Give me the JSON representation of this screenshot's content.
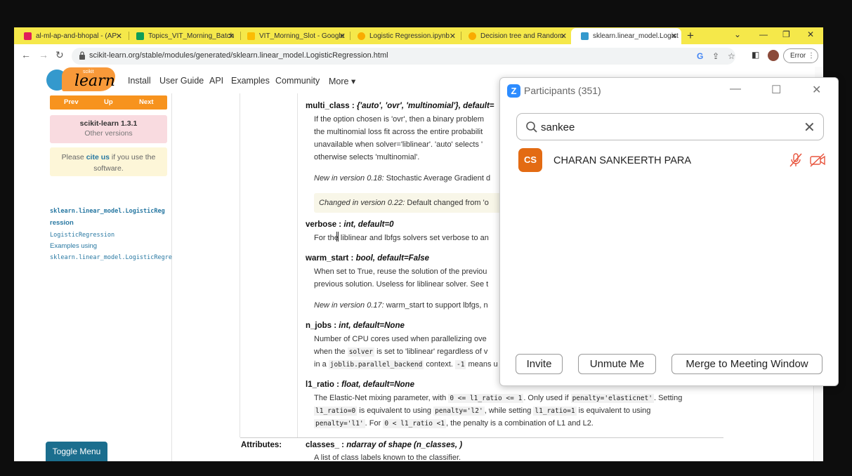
{
  "browser": {
    "tabs": [
      {
        "title": "al-ml-ap-and-bhopal - (AP",
        "favicon_color": "#e01e5a",
        "active": false
      },
      {
        "title": "Topics_VIT_Morning_Batch",
        "favicon_color": "#0f9d58",
        "active": false
      },
      {
        "title": "VIT_Morning_Slot - Google",
        "favicon_color": "#fbbc04",
        "active": false
      },
      {
        "title": "Logistic Regression.ipynb",
        "favicon_color": "#f9ab00",
        "active": false
      },
      {
        "title": "Decision tree and Random",
        "favicon_color": "#f9ab00",
        "active": false
      },
      {
        "title": "sklearn.linear_model.Logist",
        "favicon_color": "#3499cd",
        "active": true
      }
    ],
    "url": "scikit-learn.org/stable/modules/generated/sklearn.linear_model.LogisticRegression.html",
    "error_label": "Error"
  },
  "site_nav": {
    "logo_small": "scikit",
    "logo_text": "learn",
    "links": [
      "Install",
      "User Guide",
      "API",
      "Examples",
      "Community",
      "More ▾"
    ]
  },
  "sidebar": {
    "pager": {
      "prev": "Prev",
      "up": "Up",
      "next": "Next"
    },
    "version": "scikit-learn 1.3.1",
    "other_versions": "Other versions",
    "cite_pre": "Please ",
    "cite_link": "cite us",
    "cite_post": " if you use the software.",
    "toc": [
      "sklearn.linear_model.LogisticReg",
      "ression",
      "LogisticRegression",
      "Examples using",
      "sklearn.linear_model.LogisticRegre"
    ],
    "toggle_menu": "Toggle Menu"
  },
  "doc": {
    "multi_class": {
      "name": "multi_class : ",
      "type": "{'auto', 'ovr', 'multinomial'}, default=",
      "lines": [
        "If the option chosen is 'ovr', then a binary problem",
        "the multinomial loss fit across the entire probabilit",
        "unavailable when solver='liblinear'. 'auto' selects '",
        "otherwise selects 'multinomial'."
      ],
      "versionadded_label": "New in version 0.18:",
      "versionadded_text": " Stochastic Average Gradient d",
      "changed_label": "Changed in version 0.22:",
      "changed_text": " Default changed from 'o"
    },
    "verbose": {
      "name": "verbose : ",
      "type": "int, default=0",
      "line": "For the liblinear and lbfgs solvers set verbose to an"
    },
    "warm_start": {
      "name": "warm_start : ",
      "type": "bool, default=False",
      "lines": [
        "When set to True, reuse the solution of the previou",
        "previous solution. Useless for liblinear solver. See t"
      ],
      "versionadded_label": "New in version 0.17:",
      "versionadded_text": " warm_start to support lbfgs, n"
    },
    "n_jobs": {
      "name": "n_jobs : ",
      "type": "int, default=None",
      "line1": "Number of CPU cores used when parallelizing ove",
      "line2_pre": "when the ",
      "line2_code": "solver",
      "line2_post": " is set to 'liblinear' regardless of v",
      "line3_pre": "in a ",
      "line3_code": "joblib.parallel_backend",
      "line3_mid": " context. ",
      "line3_code2": "-1",
      "line3_post": " means u"
    },
    "l1_ratio": {
      "name": "l1_ratio : ",
      "type": "float, default=None",
      "l1_pre": "The Elastic-Net mixing parameter, with ",
      "l1_code1": "0 <= l1_ratio <= 1",
      "l1_mid": ". Only used if ",
      "l1_code2": "penalty='elasticnet'",
      "l1_post": ". Setting",
      "l2_code1": "l1_ratio=0",
      "l2_mid1": " is equivalent to using ",
      "l2_code2": "penalty='l2'",
      "l2_mid2": ", while setting ",
      "l2_code3": "l1_ratio=1",
      "l2_post": " is equivalent to using",
      "l3_code1": "penalty='l1'",
      "l3_mid": ". For ",
      "l3_code2": "0 < l1_ratio <1",
      "l3_post": ", the penalty is a combination of L1 and L2."
    },
    "attributes_label": "Attributes:",
    "classes": {
      "name": "classes_ : ",
      "type": "ndarray of shape (n_classes, )",
      "line": "A list of class labels known to the classifier."
    }
  },
  "zoom": {
    "title": "Participants (351)",
    "search_value": "sankee",
    "participant_initials": "CS",
    "participant_name": "CHARAN SANKEERTH PARA",
    "invite": "Invite",
    "unmute": "Unmute Me",
    "merge": "Merge to Meeting Window",
    "accent": "#2d8cff",
    "avatar_color": "#e36b13",
    "muted_color": "#e8553e"
  }
}
